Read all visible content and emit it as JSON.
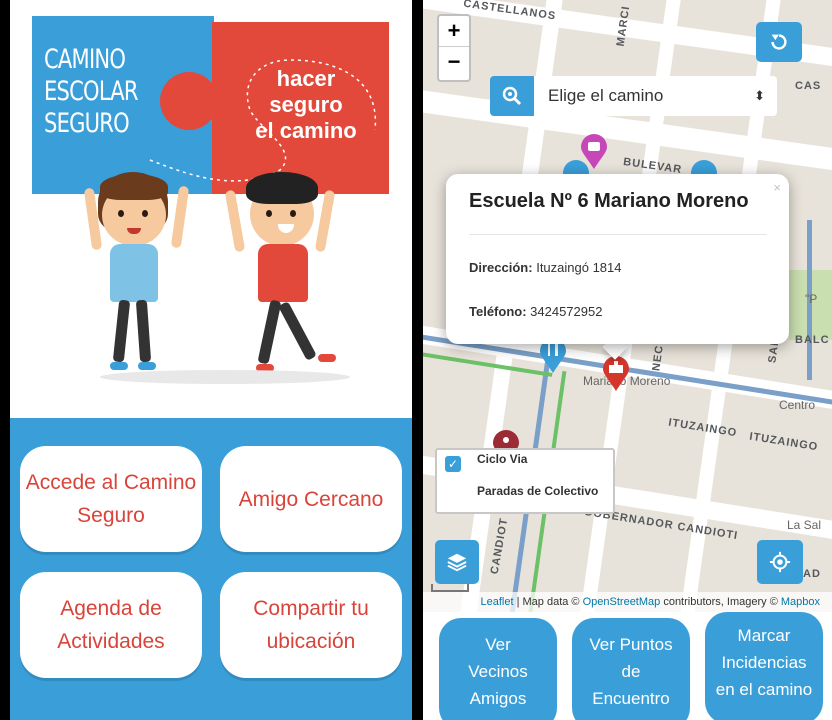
{
  "left_screen": {
    "brand": {
      "title_line1": "CAMINO",
      "title_line2": "ESCOLAR",
      "title_line3": "SEGURO",
      "slogan_line1": "hacer",
      "slogan_line2": "seguro",
      "slogan_line3": "el camino"
    },
    "menu": {
      "btn1": "Accede al Camino Seguro",
      "btn2": "Amigo Cercano",
      "btn3": "Agenda de Actividades",
      "btn4": "Compartir tu ubicación"
    },
    "colors": {
      "blue": "#3a9fd9",
      "red": "#e2493a",
      "button_text": "#d9443a"
    }
  },
  "right_screen": {
    "map_controls": {
      "zoom_in": "+",
      "zoom_out": "−"
    },
    "search": {
      "placeholder": "Elige el camino",
      "icon": "zoom-icon"
    },
    "streets": {
      "castellanos": "CASTELLANOS",
      "bulevar": "BULEVAR",
      "ituzaingo_1": "ITUZAINGO",
      "ituzaingo_2": "ITUZAINGO",
      "gobernador": "GOBERNADOR CANDIOTI",
      "candiot": "CANDIOT",
      "marci": "MARCI",
      "cas": "CAS",
      "balc": "BALC",
      "ad": "AD",
      "nec": "NEC",
      "sar": "SAR"
    },
    "places": {
      "mariano": "Mariano Moreno",
      "centro": "Centro",
      "la_sal": "La Sal",
      "p": "\"P"
    },
    "popup": {
      "close": "×",
      "title": "Escuela Nº 6 Mariano Moreno",
      "address_label": "Dirección:",
      "address_value": "Ituzaingó 1814",
      "phone_label": "Teléfono:",
      "phone_value": "3424572952"
    },
    "layers": {
      "ciclo_via": "Ciclo Via",
      "paradas": "Paradas de Colectivo",
      "ciclo_via_checked": true
    },
    "attribution": {
      "leaflet": "Leaflet",
      "map_data": " | Map data © ",
      "osm": "OpenStreetMap",
      "contributors": " contributors, Imagery © ",
      "mapbox": "Mapbox"
    },
    "scale": "100 m",
    "actions": {
      "btn1": "Ver Vecinos Amigos",
      "btn2": "Ver Puntos de Encuentro",
      "btn3": "Marcar Incidencias en el camino"
    }
  }
}
